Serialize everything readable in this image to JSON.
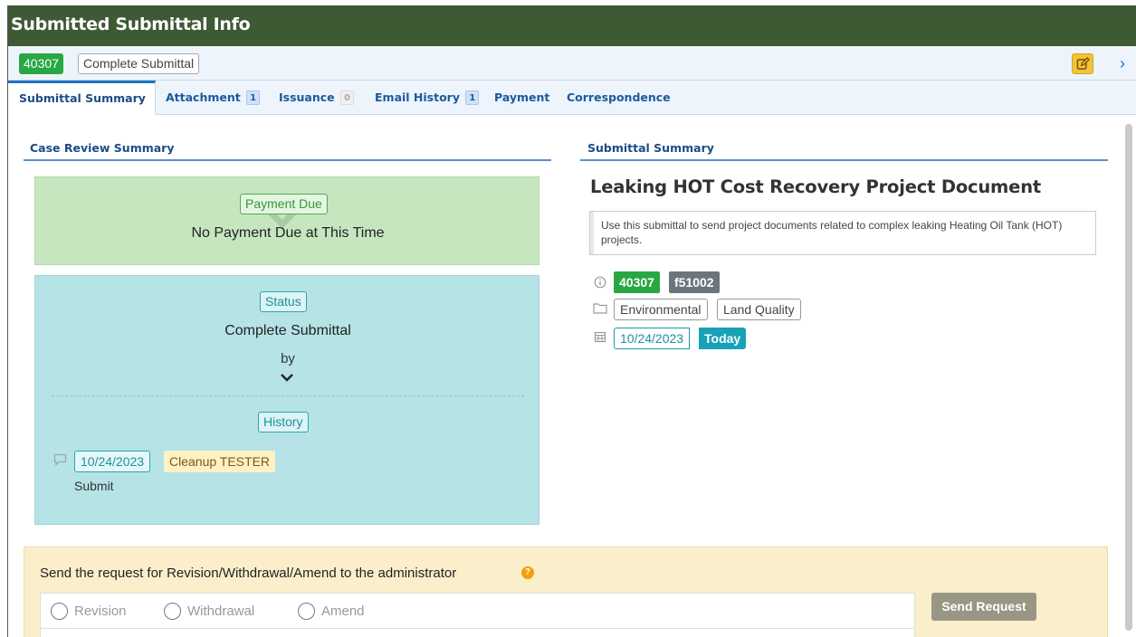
{
  "window": {
    "title": "Submitted Submittal Info"
  },
  "idbar": {
    "id": "40307",
    "state": "Complete Submittal",
    "next_label": "›"
  },
  "tabs": [
    {
      "label": "Submittal Summary",
      "count": null,
      "active": true
    },
    {
      "label": "Attachment",
      "count": "1"
    },
    {
      "label": "Issuance",
      "count": "0"
    },
    {
      "label": "Email History",
      "count": "1"
    },
    {
      "label": "Payment",
      "count": null
    },
    {
      "label": "Correspondence",
      "count": null
    }
  ],
  "left": {
    "heading": "Case Review Summary",
    "payment": {
      "chip": "Payment Due",
      "text": "No Payment Due at This Time"
    },
    "status": {
      "chip": "Status",
      "text": "Complete Submittal",
      "by": "by",
      "history_chip": "History",
      "history": [
        {
          "date": "10/24/2023",
          "user": "Cleanup TESTER",
          "action": "Submit"
        }
      ]
    }
  },
  "right": {
    "heading": "Submittal Summary",
    "doc_title": "Leaking HOT Cost Recovery Project Document",
    "description": "Use this submittal to send project documents related to complex leaking Heating Oil Tank (HOT) projects.",
    "id_tag": "40307",
    "form_tag": "f51002",
    "category_tags": [
      "Environmental",
      "Land Quality"
    ],
    "date": "10/24/2023",
    "date_badge": "Today"
  },
  "request": {
    "title": "Send the request for Revision/Withdrawal/Amend to the administrator",
    "help": "?",
    "options": [
      "Revision",
      "Withdrawal",
      "Amend"
    ],
    "button": "Send Request"
  },
  "colors": {
    "header": "#3e5a34",
    "accent": "#1e73be",
    "success": "#28a745",
    "info": "#17a2b8",
    "warning": "#f3c33c"
  }
}
